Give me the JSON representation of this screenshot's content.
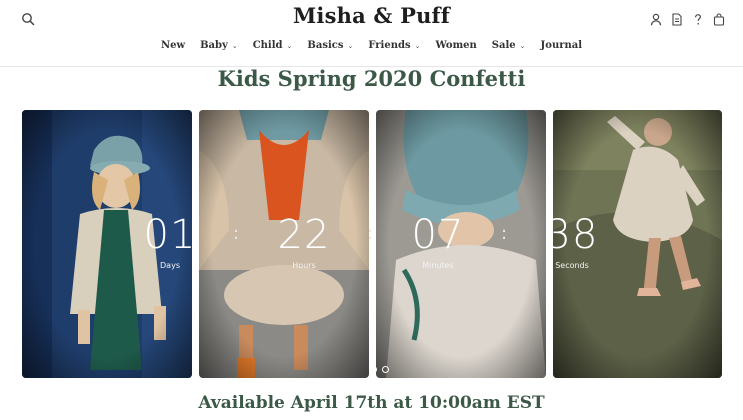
{
  "header": {
    "logo": "Misha & Puff",
    "icons": [
      "search-icon",
      "account-icon",
      "document-icon",
      "help-icon",
      "cart-icon"
    ]
  },
  "nav": {
    "items": [
      {
        "label": "New",
        "has_dropdown": false
      },
      {
        "label": "Baby",
        "has_dropdown": true
      },
      {
        "label": "Child",
        "has_dropdown": true
      },
      {
        "label": "Basics",
        "has_dropdown": true
      },
      {
        "label": "Friends",
        "has_dropdown": true
      },
      {
        "label": "Women",
        "has_dropdown": false
      },
      {
        "label": "Sale",
        "has_dropdown": true
      },
      {
        "label": "Journal",
        "has_dropdown": false
      }
    ],
    "chevron": "⌄"
  },
  "hero": {
    "title": "Kids Spring 2020 Confetti",
    "countdown": {
      "days": "01",
      "days_label": "Days",
      "hours": "22",
      "hours_label": "Hours",
      "minutes": "07",
      "minutes_label": "Minutes",
      "seconds": "38",
      "seconds_label": "Seconds",
      "separator": ":"
    },
    "availability": "Available April 17th at 10:00am EST",
    "slide_count": 2,
    "active_slide": 1
  },
  "colors": {
    "headline": "#3c5948",
    "text": "#2b2b2b",
    "countdown": "#ffffff"
  }
}
